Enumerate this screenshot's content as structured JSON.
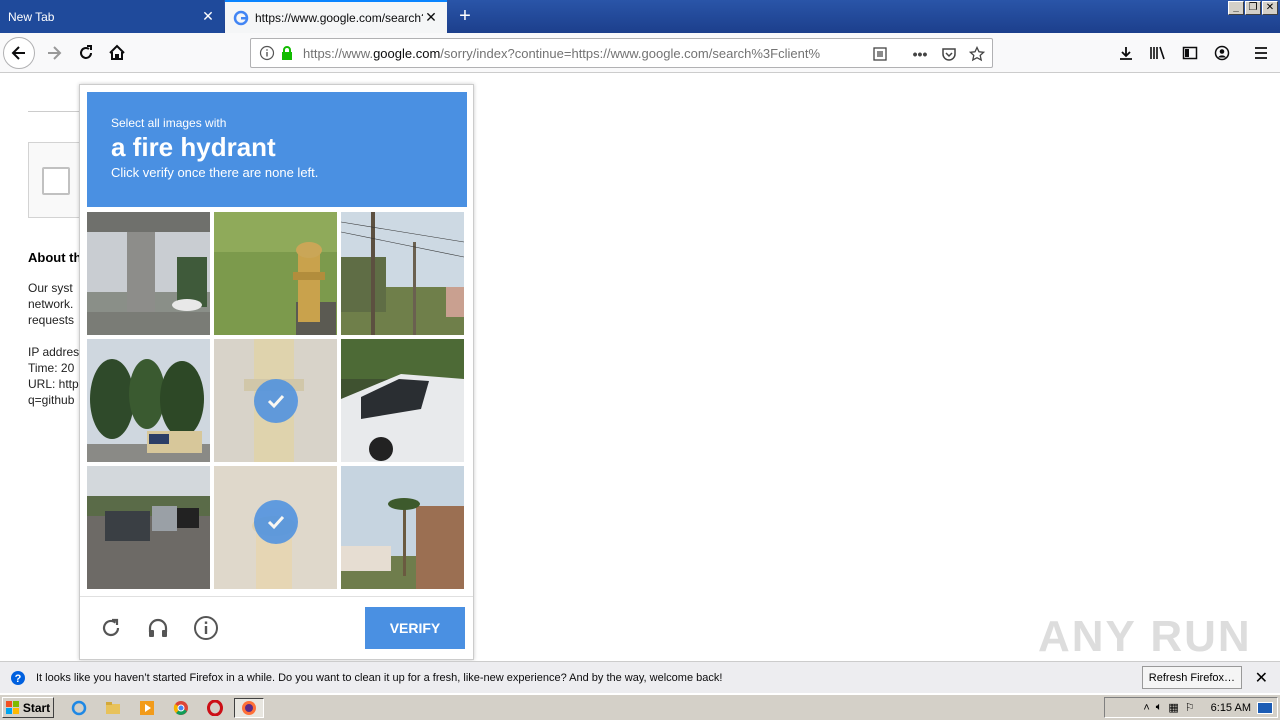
{
  "tabs": [
    {
      "title": "New Tab"
    },
    {
      "title": "https://www.google.com/search?c"
    }
  ],
  "url": {
    "prefix": "https://www.",
    "domain": "google.com",
    "rest": "/sorry/index?continue=https://www.google.com/search%3Fclient%"
  },
  "page": {
    "about_title": "About th",
    "para1": "Our syst\nnetwork.\nrequests",
    "para2": "IP addres\nTime: 20\nURL: http\nq=github"
  },
  "challenge": {
    "instruction_small": "Select all images with",
    "instruction_big": "a fire hydrant",
    "instruction_sub": "Click verify once there are none left.",
    "verify_label": "VERIFY",
    "header_color": "#4a90e2",
    "selected_tiles": [
      4,
      7
    ]
  },
  "notification": {
    "text": "It looks like you haven’t started Firefox in a while. Do you want to clean it up for a fresh, like-new experience? And by the way, welcome back!",
    "button": "Refresh Firefox…"
  },
  "taskbar": {
    "start_label": "Start",
    "clock": "6:15 AM"
  },
  "watermark": "ANY  RUN"
}
